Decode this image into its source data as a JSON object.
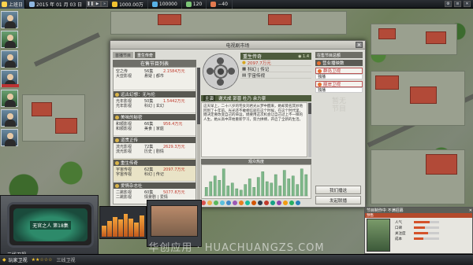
{
  "topbar": {
    "home": "上班日",
    "date": "2015 年 01 月 03 日",
    "items": [
      {
        "label": "1000.00万",
        "icon": "money-icon"
      },
      {
        "label": "100000",
        "icon": "fame-icon"
      },
      {
        "label": "120",
        "icon": "staff-icon"
      },
      {
        "label": "−40",
        "icon": "mood-icon"
      }
    ]
  },
  "window": {
    "title": "电视剧市场",
    "left": {
      "tabs": [
        "首播节目",
        "重生传奇"
      ],
      "heading": "在售节目列表",
      "programs": [
        {
          "name": "空之传",
          "r1": [
            "亚之传媒",
            "56集",
            "2.1584万元"
          ],
          "r2": [
            "大亚影视",
            "悬疑 | 都市"
          ]
        },
        {
          "name": "远古幻想：无与伦",
          "r1": [
            "光年影视",
            "50集",
            "1.5442万元"
          ],
          "r2": [
            "光年影视",
            "科幻 | 玄幻"
          ]
        },
        {
          "name": "美味的秘密",
          "r1": [
            "和顺影视",
            "66集",
            "956.4万元"
          ],
          "r2": [
            "和顺影视",
            "美食 | 家庭"
          ]
        },
        {
          "name": "道贯正传",
          "r1": [
            "流光影视",
            "72集",
            "2629.3万元"
          ],
          "r2": [
            "流光影视",
            "历史 | 剧情"
          ]
        },
        {
          "name": "重生传奇",
          "r1": [
            "宇宙传视",
            "62集",
            "2097.7万元"
          ],
          "r2": [
            "宇宙传视",
            "科幻 | 传记"
          ]
        },
        {
          "name": "爱情杂志社",
          "r1": [
            "二跳影视",
            "60集",
            "5077.8万元"
          ],
          "r2": [
            "二跳影视",
            "情景剧 | 爱情"
          ]
        }
      ]
    },
    "detail": {
      "name": "重生传奇",
      "rating": "1.4",
      "price": "2097.7万元",
      "genre": "科幻 | 传记",
      "studio": "宇宙传视",
      "cast_label": "主演",
      "cast": "谢大成  郭晋  杜乃  余力豪",
      "synopsis": "这天早上，二十八岁的宅女刘君光从梦中醒来，她却莫名其妙地回到了十年前。光光还不敢相信就在这个时候，在这个时代里，她决定要改变自己的命运，她要用这次机会让自己过上不一样的人生。她从高中开始重新学习，努力拼搏，开启了全新的生活。",
      "chart_label": "观众热度"
    },
    "right": {
      "tag": "在售节目总额",
      "heading": "营业播映数",
      "channels": [
        {
          "name": "群岛卫视",
          "sub": "独播"
        },
        {
          "name": "巅岸卫视",
          "sub": "独播"
        }
      ],
      "mark": "暂无节目",
      "buttons": [
        "我们播送",
        "发起联播"
      ]
    }
  },
  "chart_data": {
    "type": "bar",
    "title": "观众热度",
    "categories": [
      "1",
      "2",
      "3",
      "4",
      "5",
      "6",
      "7",
      "8",
      "9",
      "10",
      "11",
      "12",
      "13",
      "14",
      "15",
      "16",
      "17",
      "18",
      "19",
      "20",
      "21",
      "22",
      "23",
      "24"
    ],
    "values": [
      12,
      20,
      28,
      22,
      38,
      14,
      18,
      10,
      8,
      16,
      24,
      12,
      26,
      34,
      20,
      18,
      30,
      14,
      36,
      24,
      28,
      16,
      38,
      30
    ],
    "ylim": [
      0,
      40
    ]
  },
  "hud": {
    "tv_show": "无官之人 第18集",
    "tv_channel": "三线卫视",
    "bottom_name": "玩家卫视",
    "bottom_stars": "★★☆☆☆",
    "bottom_tier": "三线卫视",
    "right_title": "节目制作中 不满招募",
    "right_tab": "预售",
    "right_rows": [
      {
        "label": "人气",
        "value": 0.62
      },
      {
        "label": "口碑",
        "value": 0.45
      },
      {
        "label": "关注度",
        "value": 0.55
      },
      {
        "label": "成本",
        "value": 0.38
      }
    ]
  },
  "watermark": "华创应用 · HUACHUANGZS.COM",
  "colors": {
    "accent": "#4d5b3c",
    "price": "#c0392b",
    "channel": "#b33333"
  }
}
